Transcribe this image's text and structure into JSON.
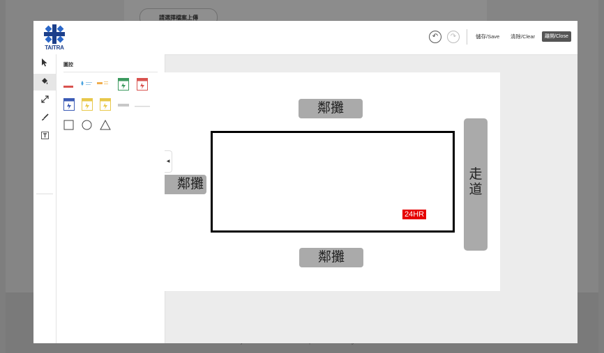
{
  "background": {
    "upload_button": "請選擇檔案上傳",
    "footer": "©2022 by Taiwan External Trade Development Council All rights reserved."
  },
  "header": {
    "logo_text": "TAITRA",
    "undo_icon": "undo-icon",
    "redo_icon": "redo-icon",
    "save_label": "儲存/Save",
    "clear_label": "清除/Clear",
    "close_label": "離開/Close"
  },
  "toolbar": {
    "tools": [
      "pointer-icon",
      "paint-bucket-icon",
      "resize-icon",
      "brush-icon",
      "text-box-icon"
    ],
    "active": "paint-bucket-icon"
  },
  "panel": {
    "title": "圖控",
    "shapes": [
      "square",
      "circle",
      "triangle"
    ]
  },
  "canvas": {
    "stall_top": "鄰攤",
    "stall_left": "鄰攤",
    "stall_bottom": "鄰攤",
    "tag": "24HR",
    "aisle": "走道",
    "tag_color": "#e60000",
    "block_color": "#aaaaaa"
  }
}
